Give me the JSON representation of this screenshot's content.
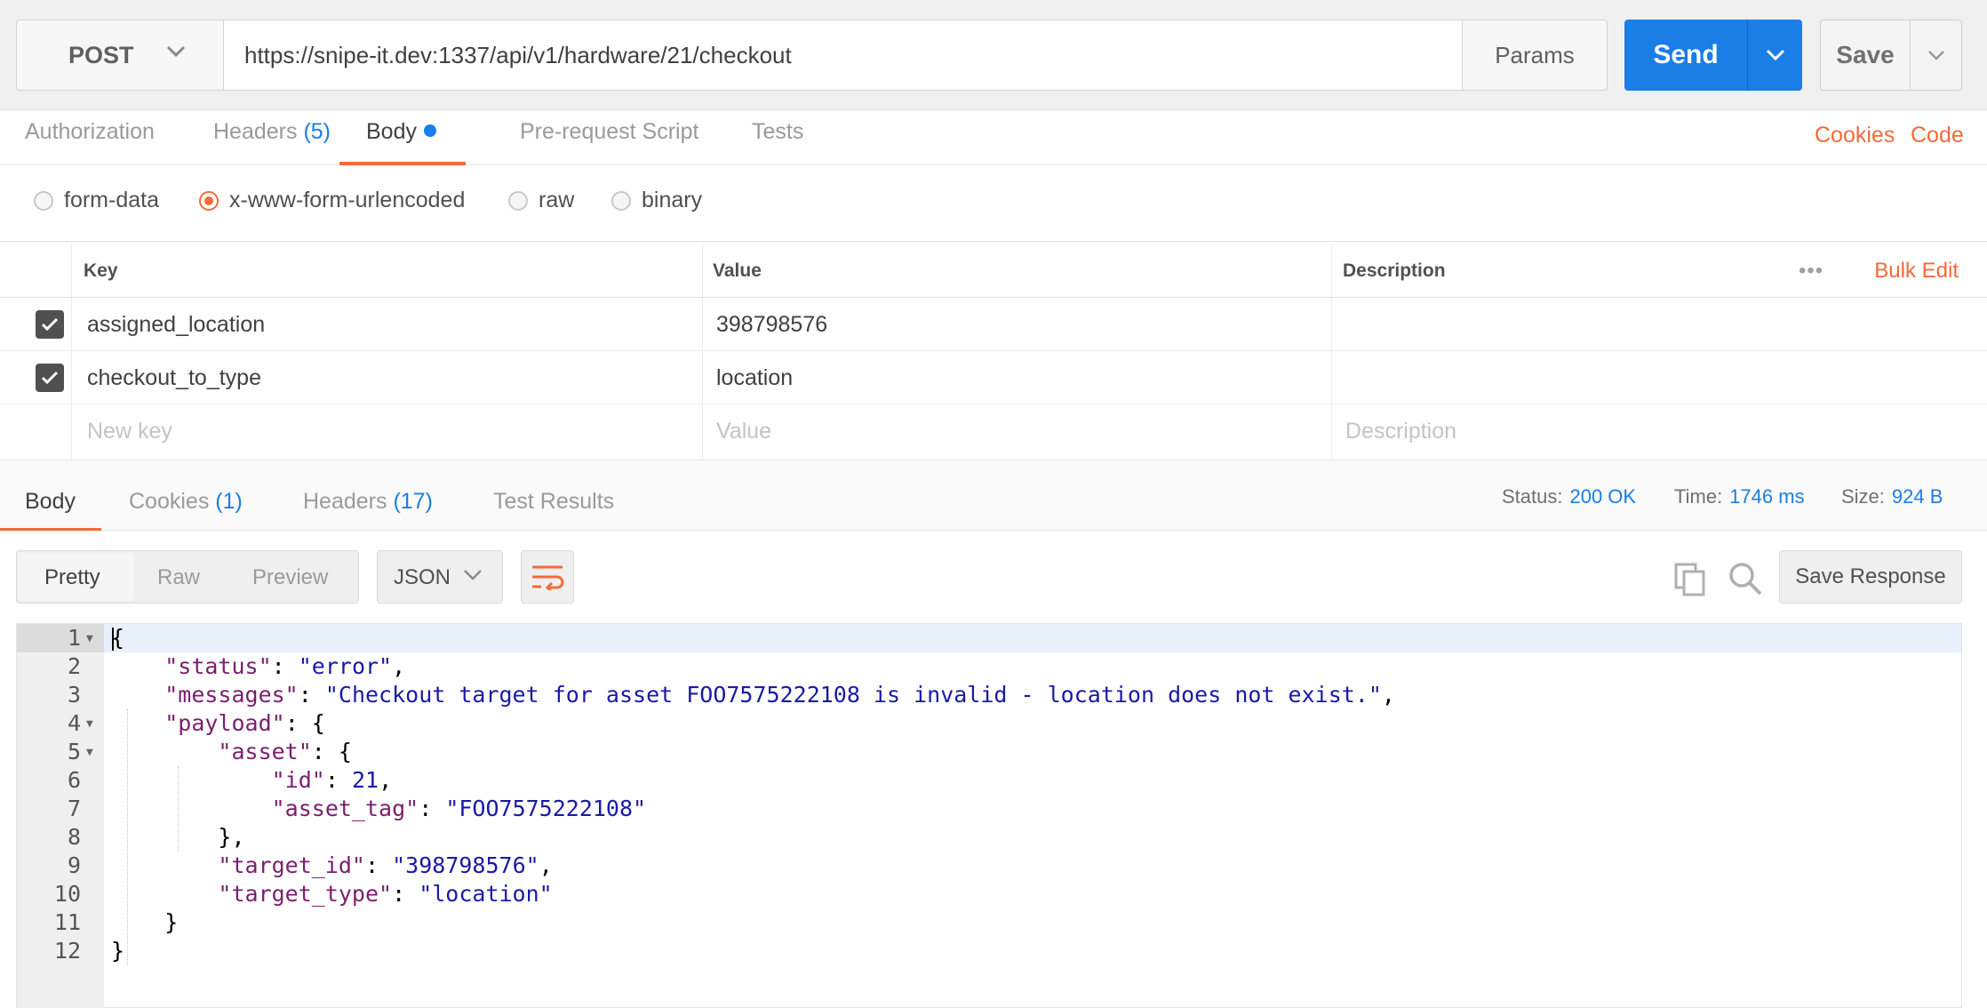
{
  "request": {
    "method": "POST",
    "url": "https://snipe-it.dev:1337/api/v1/hardware/21/checkout",
    "params_label": "Params",
    "send_label": "Send",
    "save_label": "Save"
  },
  "request_tabs": {
    "authorization": "Authorization",
    "headers": "Headers",
    "headers_count": "(5)",
    "body": "Body",
    "prerequest": "Pre-request Script",
    "tests": "Tests",
    "cookies": "Cookies",
    "code": "Code"
  },
  "body_types": {
    "form_data": "form-data",
    "urlencoded": "x-www-form-urlencoded",
    "raw": "raw",
    "binary": "binary",
    "selected": "x-www-form-urlencoded"
  },
  "kv_table": {
    "headers": {
      "key": "Key",
      "value": "Value",
      "description": "Description",
      "bulk_edit": "Bulk Edit",
      "more": "•••"
    },
    "rows": [
      {
        "key": "assigned_location",
        "value": "398798576",
        "description": "",
        "checked": true
      },
      {
        "key": "checkout_to_type",
        "value": "location",
        "description": "",
        "checked": true
      }
    ],
    "placeholders": {
      "key": "New key",
      "value": "Value",
      "description": "Description"
    }
  },
  "response_tabs": {
    "body": "Body",
    "cookies": "Cookies",
    "cookies_count": "(1)",
    "headers": "Headers",
    "headers_count": "(17)",
    "test_results": "Test Results"
  },
  "response_status": {
    "status_label": "Status:",
    "status_value": "200 OK",
    "time_label": "Time:",
    "time_value": "1746 ms",
    "size_label": "Size:",
    "size_value": "924 B"
  },
  "response_toolbar": {
    "pretty": "Pretty",
    "raw": "Raw",
    "preview": "Preview",
    "format": "JSON",
    "save_response": "Save Response"
  },
  "response_body": {
    "line_numbers": [
      "1",
      "2",
      "3",
      "4",
      "5",
      "6",
      "7",
      "8",
      "9",
      "10",
      "11",
      "12"
    ],
    "status_key": "\"status\"",
    "status_val": "\"error\"",
    "messages_key": "\"messages\"",
    "messages_val": "\"Checkout target for asset FOO7575222108 is invalid - location does not exist.\"",
    "payload_key": "\"payload\"",
    "asset_key": "\"asset\"",
    "id_key": "\"id\"",
    "id_val": "21",
    "asset_tag_key": "\"asset_tag\"",
    "asset_tag_val": "\"FOO7575222108\"",
    "target_id_key": "\"target_id\"",
    "target_id_val": "\"398798576\"",
    "target_type_key": "\"target_type\"",
    "target_type_val": "\"location\""
  },
  "colors": {
    "accent_orange": "#f26b3a",
    "accent_blue": "#1a7ee6",
    "json_key": "#7a1e6e",
    "json_string": "#1a1aa6"
  }
}
